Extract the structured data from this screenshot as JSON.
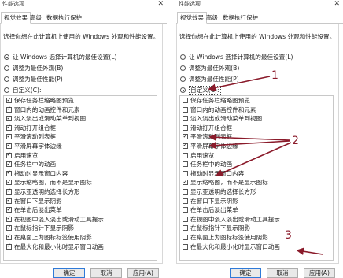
{
  "window": {
    "title": "性能选项",
    "close_glyph": "✕"
  },
  "tabs": [
    "视觉效果",
    "高级",
    "数据执行保护"
  ],
  "description": "选择你想在此计算机上使用的 Windows 外观和性能设置。",
  "radios": [
    "让 Windows 选择计算机的最佳设置(L)",
    "调整为最佳外观(B)",
    "调整为最佳性能(P)",
    "自定义(C):"
  ],
  "items": [
    "保存任务栏缩略图预览",
    "窗口内的动画控件和元素",
    "淡入淡出或滑动菜单到视图",
    "滑动打开组合框",
    "平滑滚动列表框",
    "平滑屏幕字体边缘",
    "启用速览",
    "任务栏中的动画",
    "拖动时显示窗口内容",
    "显示缩略图，而不是显示图标",
    "显示亚透明的选择长方形",
    "在窗口下显示阴影",
    "在单击后淡出菜单",
    "在视图中淡入淡出或滑动工具提示",
    "在鼠标指针下显示阴影",
    "在桌面上为图标标签使用阴影",
    "在最大化和最小化时显示窗口动画"
  ],
  "left": {
    "selected_radio": 0,
    "checked": [
      true,
      true,
      true,
      true,
      true,
      true,
      true,
      true,
      true,
      true,
      true,
      true,
      true,
      true,
      true,
      true,
      true
    ]
  },
  "right": {
    "selected_radio": 3,
    "checked": [
      false,
      false,
      false,
      false,
      true,
      true,
      false,
      false,
      false,
      true,
      false,
      false,
      false,
      false,
      false,
      false,
      false
    ]
  },
  "buttons": {
    "ok": "确定",
    "cancel": "取消",
    "apply": "应用(A)"
  },
  "annotations": {
    "one": "1",
    "two": "2",
    "three": "3",
    "color": "#8a1a2a"
  }
}
